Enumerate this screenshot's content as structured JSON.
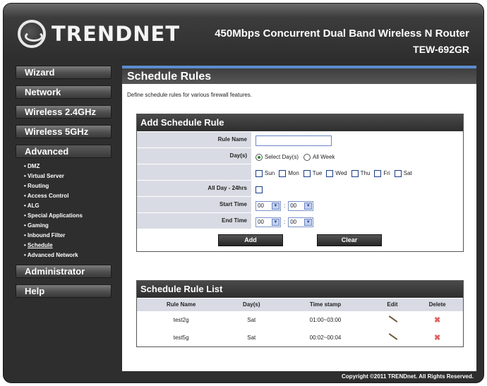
{
  "header": {
    "brand": "TRENDNET",
    "product_title": "450Mbps Concurrent Dual Band Wireless N Router",
    "model": "TEW-692GR"
  },
  "sidebar": {
    "top_items": [
      {
        "label": "Wizard"
      },
      {
        "label": "Network"
      },
      {
        "label": "Wireless 2.4GHz"
      },
      {
        "label": "Wireless 5GHz"
      },
      {
        "label": "Advanced"
      }
    ],
    "advanced_items": [
      "DMZ",
      "Virtual Server",
      "Routing",
      "Access Control",
      "ALG",
      "Special Applications",
      "Gaming",
      "Inbound Filter",
      "Schedule",
      "Advanced Network"
    ],
    "bottom_items": [
      {
        "label": "Administrator"
      },
      {
        "label": "Help"
      }
    ]
  },
  "page": {
    "title": "Schedule Rules",
    "description": "Define schedule rules for various firewall features."
  },
  "add_rule": {
    "heading": "Add Schedule Rule",
    "rule_name_label": "Rule Name",
    "rule_name_value": "",
    "days_label": "Day(s)",
    "select_days_label": "Select Day(s)",
    "all_week_label": "All Week",
    "selected_option": "Select Day(s)",
    "days": [
      "Sun",
      "Mon",
      "Tue",
      "Wed",
      "Thu",
      "Fri",
      "Sat"
    ],
    "all_day_label": "All Day - 24hrs",
    "start_time_label": "Start Time",
    "start_hour": "00",
    "start_min": "00",
    "end_time_label": "End Time",
    "end_hour": "00",
    "end_min": "00",
    "time_separator": ":",
    "add_button": "Add",
    "clear_button": "Clear"
  },
  "rule_list": {
    "heading": "Schedule Rule List",
    "columns": [
      "Rule Name",
      "Day(s)",
      "Time stamp",
      "Edit",
      "Delete"
    ],
    "rows": [
      {
        "name": "test2g",
        "days": "Sat",
        "time": "01:00~03:00"
      },
      {
        "name": "test5g",
        "days": "Sat",
        "time": "00:02~00:04"
      }
    ]
  },
  "footer": {
    "copyright": "Copyright ©2011 TRENDnet. All Rights Reserved."
  },
  "colors": {
    "title_accent": "#5b8ccf",
    "label_cell_bg": "#d9dbe4",
    "frame_bg": "#2e2e2e",
    "delete_icon": "#e06060"
  }
}
